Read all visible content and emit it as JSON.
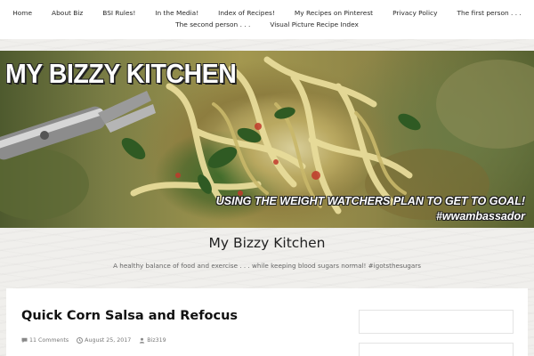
{
  "nav": {
    "row1": [
      {
        "label": "Home"
      },
      {
        "label": "About Biz"
      },
      {
        "label": "BSI Rules!"
      },
      {
        "label": "In the Media!"
      },
      {
        "label": "Index of Recipes!"
      },
      {
        "label": "My Recipes on Pinterest"
      },
      {
        "label": "Privacy Policy"
      },
      {
        "label": "The first person . . ."
      }
    ],
    "row2": [
      {
        "label": "The second person . . ."
      },
      {
        "label": "Visual Picture Recipe Index"
      }
    ]
  },
  "banner": {
    "title": "MY BIZZY KITCHEN",
    "slogan": "USING THE WEIGHT WATCHERS PLAN TO GET TO GOAL!",
    "hashtag": "#wwambassador"
  },
  "site": {
    "title": "My Bizzy Kitchen",
    "description": "A healthy balance of food and exercise . . . while keeping blood sugars normal! #igotsthesugars"
  },
  "post": {
    "title": "Quick Corn Salsa and Refocus",
    "comments": "11 Comments",
    "date": "August 25, 2017",
    "author": "Biz319"
  },
  "colors": {
    "nav_bg": "#ffffff",
    "page_bg": "#f0efec",
    "text": "#222222"
  }
}
